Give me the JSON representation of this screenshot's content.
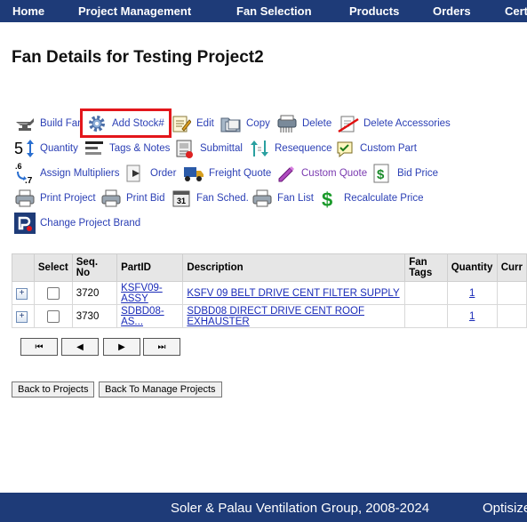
{
  "nav": [
    "Home",
    "Project Management",
    "Fan Selection",
    "Products",
    "Orders",
    "Cert"
  ],
  "page_title": "Fan Details for Testing Project2",
  "toolbar": {
    "build_fan": "Build Fan",
    "add_stock": "Add Stock#",
    "edit": "Edit",
    "copy": "Copy",
    "delete": "Delete",
    "delete_accessories": "Delete Accessories",
    "quantity": "Quantity",
    "tags_notes": "Tags & Notes",
    "submittal": "Submittal",
    "resequence": "Resequence",
    "custom_part": "Custom Part",
    "assign_multipliers": "Assign Multipliers",
    "order": "Order",
    "freight_quote": "Freight Quote",
    "custom_quote": "Custom Quote",
    "bid_price": "Bid Price",
    "print_project": "Print Project",
    "print_bid": "Print Bid",
    "fan_sched": "Fan Sched.",
    "fan_list": "Fan List",
    "recalculate_price": "Recalculate Price",
    "change_project_brand": "Change Project Brand",
    "quantity_icon_digit": "5",
    "multiplier_icon_top": ".6",
    "multiplier_icon_bottom": ".7"
  },
  "grid": {
    "headers": [
      "Select",
      "Seq. No",
      "PartID",
      "Description",
      "Fan Tags",
      "Quantity",
      "Curr"
    ],
    "rows": [
      {
        "seq": "3720",
        "part_id": "KSFV09-ASSY",
        "description": "KSFV 09 BELT DRIVE CENT FILTER SUPPLY",
        "fan_tags": "",
        "quantity": "1"
      },
      {
        "seq": "3730",
        "part_id": "SDBD08-AS...",
        "description": "SDBD08 DIRECT DRIVE CENT ROOF EXHAUSTER",
        "fan_tags": "",
        "quantity": "1"
      }
    ]
  },
  "pager": {
    "first": "⏮",
    "prev": "◀",
    "next": "▶",
    "last": "⏭"
  },
  "buttons": {
    "back_to_projects": "Back to Projects",
    "back_to_manage": "Back To Manage Projects"
  },
  "footer": {
    "copyright": "Soler & Palau Ventilation Group, 2008-2024",
    "optisize": "Optisize"
  },
  "colors": {
    "nav_bg": "#1e3b78",
    "link": "#2b3fb5",
    "highlight": "#e3161b"
  }
}
